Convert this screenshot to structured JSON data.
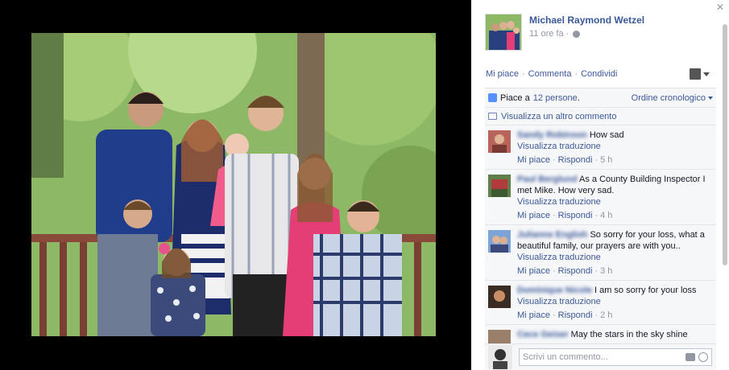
{
  "post": {
    "author_name": "Michael Raymond Wetzel",
    "time": "11 ore fa",
    "time_sep": "·"
  },
  "actions": {
    "like": "Mi piace",
    "comment": "Commenta",
    "share": "Condividi",
    "sep": "·"
  },
  "likes": {
    "prefix": "Piace a",
    "link": "12 persone",
    "suffix": ".",
    "order": "Ordine cronologico"
  },
  "more_comments": "Visualizza un altro commento",
  "comments": [
    {
      "name": "Sandy Robinson",
      "text": "How sad",
      "translate": "Visualizza traduzione",
      "like": "Mi piace",
      "reply": "Rispondi",
      "time": "5 h"
    },
    {
      "name": "Paul Berglund",
      "text": "As a County Building Inspector I met Mike. How very sad.",
      "translate": "Visualizza traduzione",
      "like": "Mi piace",
      "reply": "Rispondi",
      "time": "4 h"
    },
    {
      "name": "Julianne English",
      "text": "So sorry for your loss, what a beautiful family, our prayers are with you..",
      "translate": "Visualizza traduzione",
      "like": "Mi piace",
      "reply": "Rispondi",
      "time": "3 h"
    },
    {
      "name": "Dominique Nicole",
      "text": "I am so sorry for your loss",
      "translate": "Visualizza traduzione",
      "like": "Mi piace",
      "reply": "Rispondi",
      "time": "2 h"
    },
    {
      "name": "Cece Geiser",
      "text": "May the stars in the sky shine"
    }
  ],
  "composer": {
    "placeholder": "Scrivi un commento..."
  },
  "icons": {
    "close": "close-icon",
    "globe": "globe-icon",
    "thumb": "like-thumb-icon",
    "bubble": "comment-bubble-icon",
    "camera": "camera-icon",
    "smile": "emoticon-icon"
  },
  "colors": {
    "link": "#3b5998",
    "muted": "#9197a3",
    "panel_bg": "#f6f7f9",
    "stage_bg": "#000000"
  }
}
